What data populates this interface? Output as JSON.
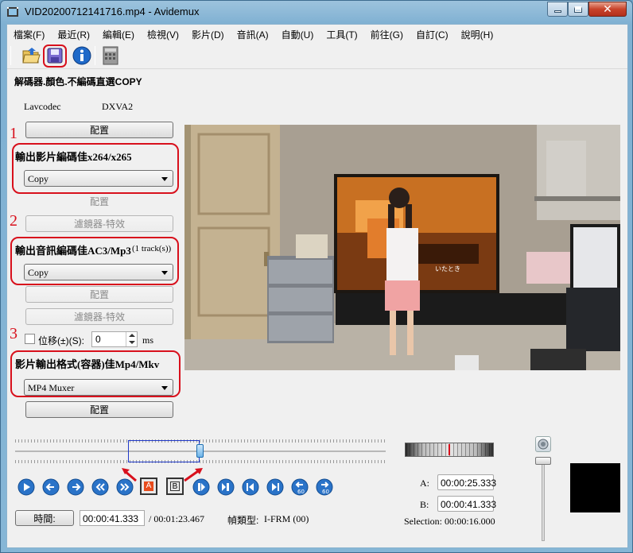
{
  "window": {
    "title": "VID20200712141716.mp4 - Avidemux"
  },
  "menu": [
    "檔案(F)",
    "最近(R)",
    "編輯(E)",
    "檢視(V)",
    "影片(D)",
    "音訊(A)",
    "自動(U)",
    "工具(T)",
    "前往(G)",
    "自訂(C)",
    "說明(H)"
  ],
  "toolbar": {
    "icons": [
      "open-folder-icon",
      "save-video-icon",
      "info-icon",
      "calculator-icon"
    ]
  },
  "decoder": {
    "heading": "解碼器.顏色.不編碼直選COPY",
    "codec": "Lavcodec",
    "hw": "DXVA2",
    "config": "配置"
  },
  "video_output": {
    "step": "1",
    "heading": "輸出影片編碼佳x264/x265",
    "value": "Copy",
    "config": "配置",
    "filters": "濾鏡器-特效"
  },
  "audio_output": {
    "step": "2",
    "heading": "輸出音訊編碼佳AC3/Mp3",
    "tracks": "(1 track(s))",
    "value": "Copy",
    "config": "配置",
    "filters": "濾鏡器-特效"
  },
  "shift": {
    "step": "3",
    "label": "位移(±)(S):",
    "value": "0",
    "unit": "ms"
  },
  "container": {
    "heading": "影片輸出格式(容器)佳Mp4/Mkv",
    "value": "MP4 Muxer",
    "config": "配置"
  },
  "markers": {
    "a_label": "A:",
    "a_value": "00:00:25.333",
    "b_label": "B:",
    "b_value": "00:00:41.333",
    "selection": "Selection: 00:00:16.000"
  },
  "status": {
    "time_button": "時間:",
    "current_time": "00:00:41.333",
    "total_time": "/ 00:01:23.467",
    "frame_type_label": "幀類型:",
    "frame_type_value": "I-FRM (00)"
  },
  "playback": {
    "a_marker": "A",
    "b_marker": "B",
    "rewind_label": "60",
    "forward_label": "60"
  },
  "video_overlay": {
    "tv_text": "いたとき"
  },
  "colors": {
    "highlight": "#d8101c",
    "selection_box": "#1f39c9",
    "button_blue": "#2a73c8"
  }
}
